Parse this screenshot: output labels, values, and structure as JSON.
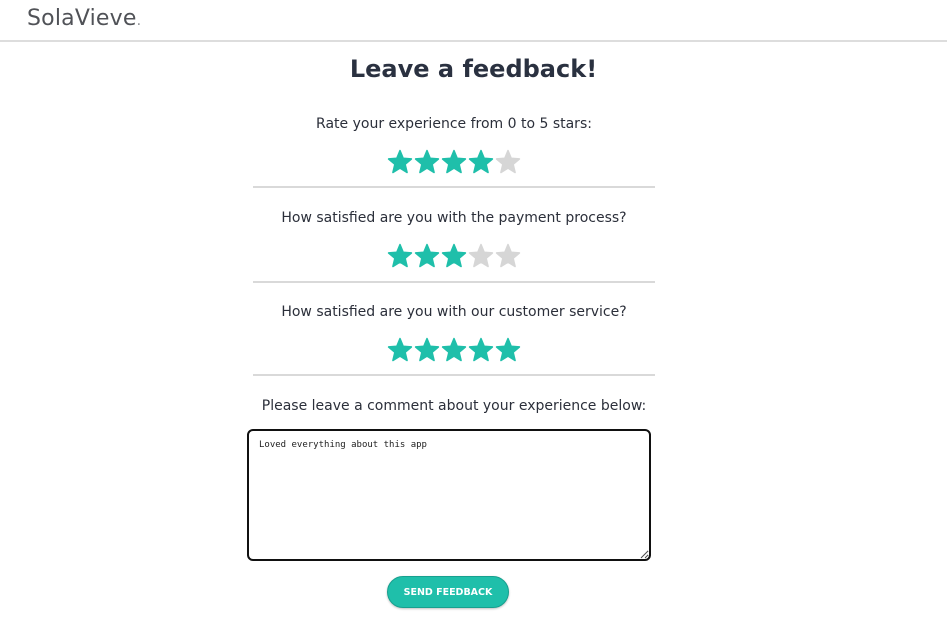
{
  "brand": {
    "name": "SolaVieve",
    "dot": "."
  },
  "page": {
    "title": "Leave a feedback!"
  },
  "ratings": [
    {
      "question": "Rate your experience from 0 to 5 stars:",
      "value": 4,
      "max": 5
    },
    {
      "question": "How satisfied are you with the payment process?",
      "value": 3,
      "max": 5
    },
    {
      "question": "How satisfied are you with our customer service?",
      "value": 5,
      "max": 5
    }
  ],
  "comment": {
    "prompt": "Please leave a comment about your experience below:",
    "value": "Loved everything about this app"
  },
  "actions": {
    "send_label": "Send feedback"
  },
  "colors": {
    "accent": "#1fbfaa",
    "star_filled": "#1fbfaa",
    "star_empty": "#d6d6d6"
  },
  "icons": {
    "star": "star-icon"
  }
}
